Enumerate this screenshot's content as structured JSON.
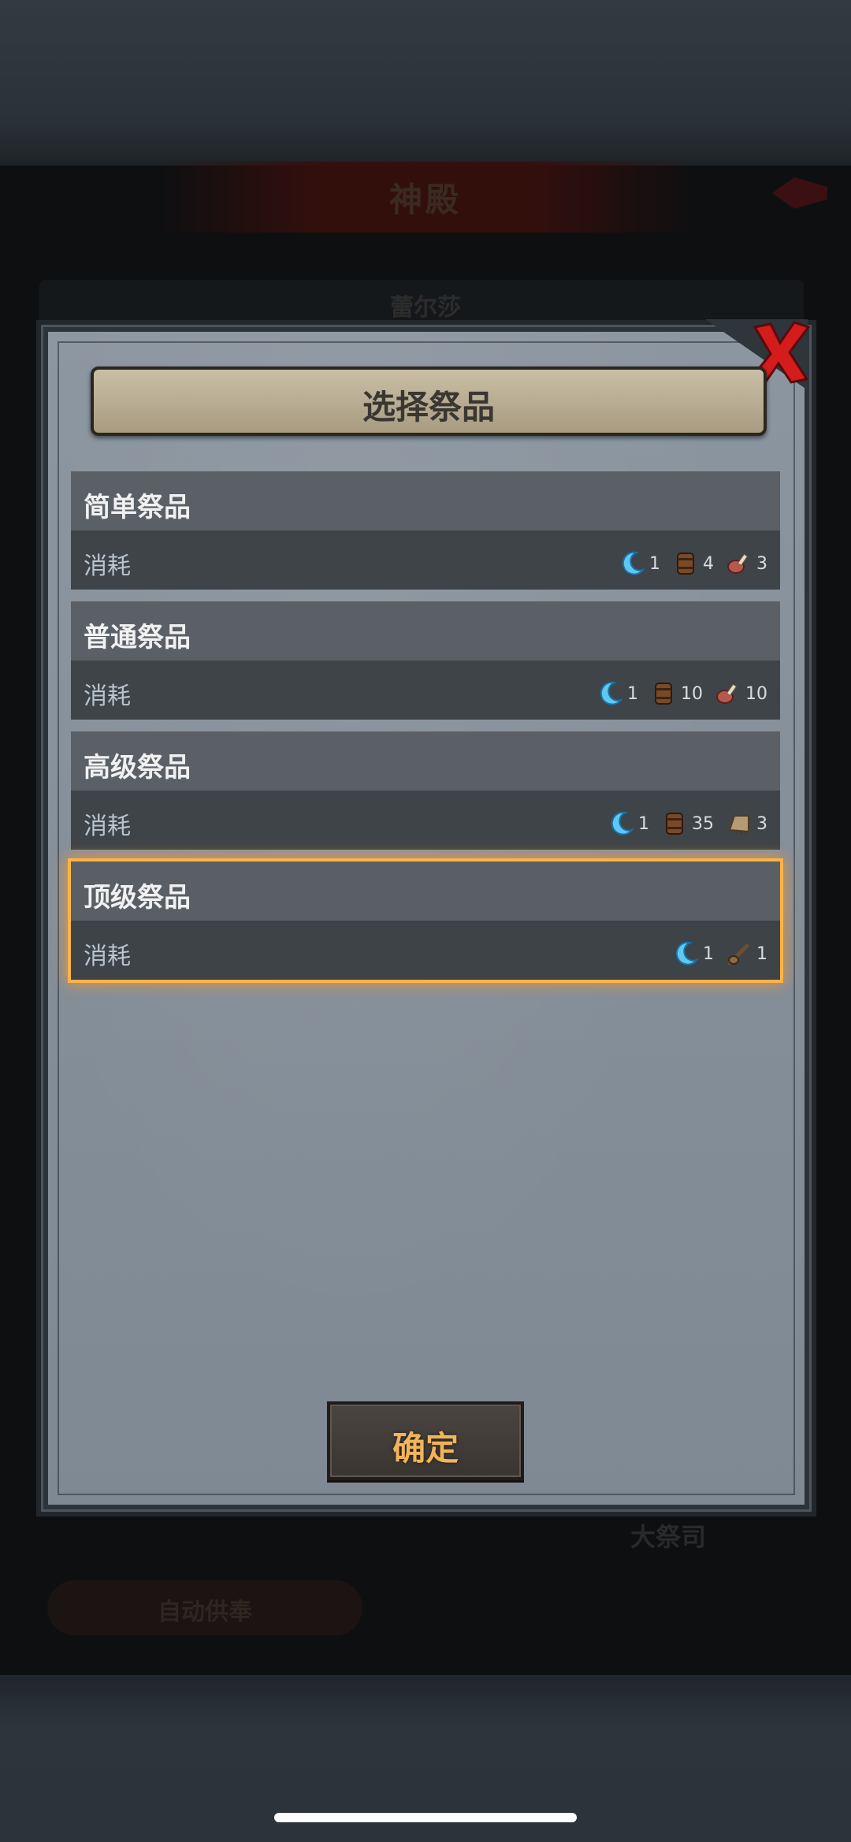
{
  "background": {
    "title": "神殿",
    "name": "蕾尔莎",
    "priest_label": "大祭司",
    "auto_label": "自动供奉"
  },
  "modal": {
    "title": "选择祭品",
    "confirm_label": "确定",
    "options": [
      {
        "name": "简单祭品",
        "cost_label": "消耗",
        "selected": false,
        "costs": [
          {
            "icon": "moon-crystal-icon",
            "amount": "1"
          },
          {
            "icon": "wood-barrel-icon",
            "amount": "4"
          },
          {
            "icon": "meat-leg-icon",
            "amount": "3"
          }
        ]
      },
      {
        "name": "普通祭品",
        "cost_label": "消耗",
        "selected": false,
        "costs": [
          {
            "icon": "moon-crystal-icon",
            "amount": "1"
          },
          {
            "icon": "wood-barrel-icon",
            "amount": "10"
          },
          {
            "icon": "meat-leg-icon",
            "amount": "10"
          }
        ]
      },
      {
        "name": "高级祭品",
        "cost_label": "消耗",
        "selected": false,
        "costs": [
          {
            "icon": "moon-crystal-icon",
            "amount": "1"
          },
          {
            "icon": "wood-barrel-icon",
            "amount": "35"
          },
          {
            "icon": "fur-paw-icon",
            "amount": "3"
          }
        ]
      },
      {
        "name": "顶级祭品",
        "cost_label": "消耗",
        "selected": true,
        "costs": [
          {
            "icon": "moon-crystal-icon",
            "amount": "1"
          },
          {
            "icon": "bone-club-icon",
            "amount": "1"
          }
        ]
      }
    ]
  },
  "colors": {
    "selected_glow": "#ffb347",
    "confirm_text": "#f2b45a",
    "close_red": "#d41c1c"
  }
}
